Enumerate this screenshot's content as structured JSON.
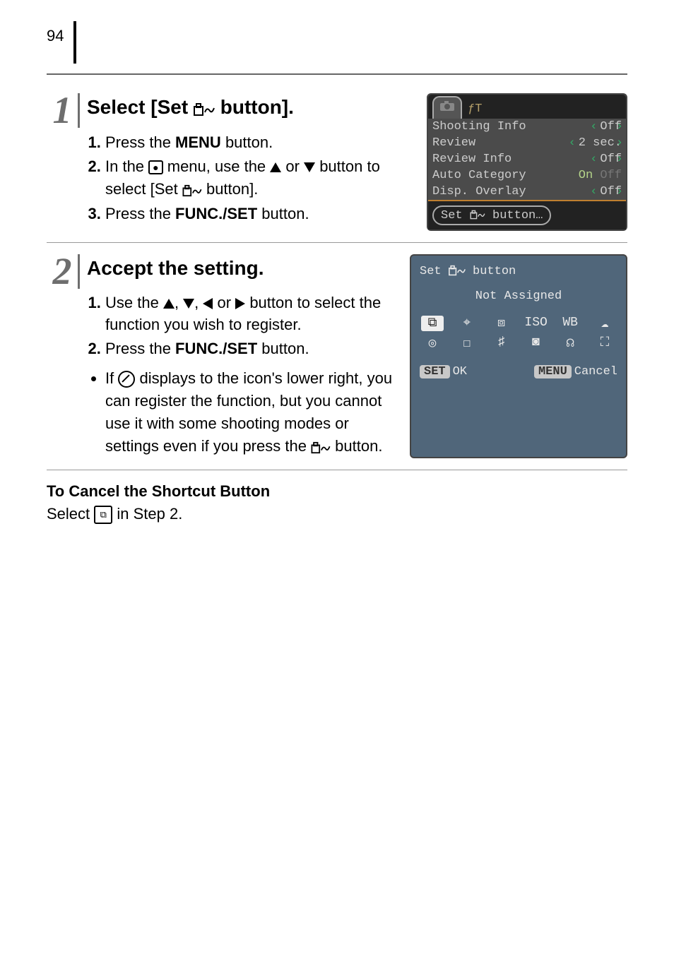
{
  "page": {
    "number": "94"
  },
  "step1": {
    "title_pre": "Select [Set ",
    "title_post": " button].",
    "items": {
      "i1_pre": "Press the ",
      "i1_strong": "MENU",
      "i1_post": " button.",
      "i2_pre": "In the ",
      "i2_mid": " menu, use the ",
      "i2_or": " or ",
      "i2_post1": " button to select [Set ",
      "i2_post2": " button].",
      "i3_pre": "Press the ",
      "i3_strong": "FUNC./SET",
      "i3_post": " button."
    },
    "screen": {
      "rows": [
        {
          "label": "Shooting Info",
          "value": "Off"
        },
        {
          "label": "Review",
          "value": "2 sec."
        },
        {
          "label": "Review Info",
          "value": "Off"
        },
        {
          "label": "Auto Category",
          "value": "On",
          "value2": "Off"
        },
        {
          "label": "Disp. Overlay",
          "value": "Off"
        }
      ],
      "set_label_pre": "Set ",
      "set_label_post": " button…"
    }
  },
  "step2": {
    "title": "Accept the setting.",
    "items": {
      "i1_pre": "Use the ",
      "c1": ", ",
      "c2": ", ",
      "c3": " or ",
      "i1_post": " button to select the function you wish to register.",
      "i2_pre": "Press the ",
      "i2_strong": "FUNC./SET",
      "i2_post": " button."
    },
    "bullet": {
      "b_pre": "If ",
      "b_mid": " displays to the icon's lower right, you can register the function, but you cannot use it with some shooting modes or settings even if you press the ",
      "b_post": " button."
    },
    "screen": {
      "head_pre": "Set ",
      "head_post": " button",
      "sub": "Not Assigned",
      "icons_row1": [
        "⧉",
        "⌖",
        "⧈",
        "ISO",
        "WB",
        "☁"
      ],
      "icons_row2": [
        "◎",
        "☐",
        "♯",
        "◙",
        "☊",
        "⛶"
      ],
      "ok_btn": "SET",
      "ok_lbl": "OK",
      "cancel_btn": "MENU",
      "cancel_lbl": "Cancel"
    }
  },
  "cancel": {
    "heading": "To Cancel the Shortcut Button",
    "body_pre": "Select ",
    "body_post": " in Step 2."
  }
}
